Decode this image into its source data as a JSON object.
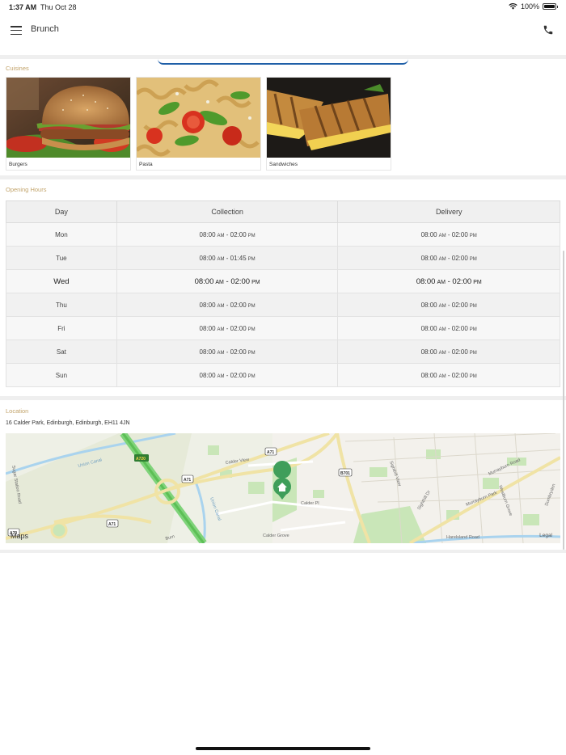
{
  "status_bar": {
    "time": "1:37 AM",
    "date": "Thu Oct 28",
    "battery": "100%",
    "battery_level": 1.0
  },
  "header": {
    "title": "Brunch"
  },
  "cuisines": {
    "label": "Cuisines",
    "items": [
      {
        "name": "Burgers"
      },
      {
        "name": "Pasta"
      },
      {
        "name": "Sandwiches"
      }
    ]
  },
  "hours": {
    "label": "Opening Hours",
    "columns": [
      "Day",
      "Collection",
      "Delivery"
    ],
    "rows": [
      {
        "day": "Mon",
        "collection": [
          "08:00",
          "AM",
          "02:00",
          "PM"
        ],
        "delivery": [
          "08:00",
          "AM",
          "02:00",
          "PM"
        ]
      },
      {
        "day": "Tue",
        "collection": [
          "08:00",
          "AM",
          "01:45",
          "PM"
        ],
        "delivery": [
          "08:00",
          "AM",
          "02:00",
          "PM"
        ]
      },
      {
        "day": "Wed",
        "collection": [
          "08:00",
          "AM",
          "02:00",
          "PM"
        ],
        "delivery": [
          "08:00",
          "AM",
          "02:00",
          "PM"
        ]
      },
      {
        "day": "Thu",
        "collection": [
          "08:00",
          "AM",
          "02:00",
          "PM"
        ],
        "delivery": [
          "08:00",
          "AM",
          "02:00",
          "PM"
        ]
      },
      {
        "day": "Fri",
        "collection": [
          "08:00",
          "AM",
          "02:00",
          "PM"
        ],
        "delivery": [
          "08:00",
          "AM",
          "02:00",
          "PM"
        ]
      },
      {
        "day": "Sat",
        "collection": [
          "08:00",
          "AM",
          "02:00",
          "PM"
        ],
        "delivery": [
          "08:00",
          "AM",
          "02:00",
          "PM"
        ]
      },
      {
        "day": "Sun",
        "collection": [
          "08:00",
          "AM",
          "02:00",
          "PM"
        ],
        "delivery": [
          "08:00",
          "AM",
          "02:00",
          "PM"
        ]
      }
    ]
  },
  "location": {
    "label": "Location",
    "address": "16   Calder Park, Edinburgh, Edinburgh, EH11 4JN",
    "map": {
      "credit": "Maps",
      "legal": "Legal",
      "roads": [
        "A720",
        "A71",
        "A71",
        "A71",
        "B701",
        "A70",
        "Calder View",
        "Calder Pl",
        "Calder Grove",
        "Union Canal",
        "Union Canal",
        "Murrayburn Road",
        "Murrayburn Park",
        "Harelsland Road",
        "Sighthill Dr",
        "Sighthill View",
        "Sugar Station Road",
        "Dumbryden",
        "Westburn Grove",
        "Burn"
      ]
    }
  }
}
